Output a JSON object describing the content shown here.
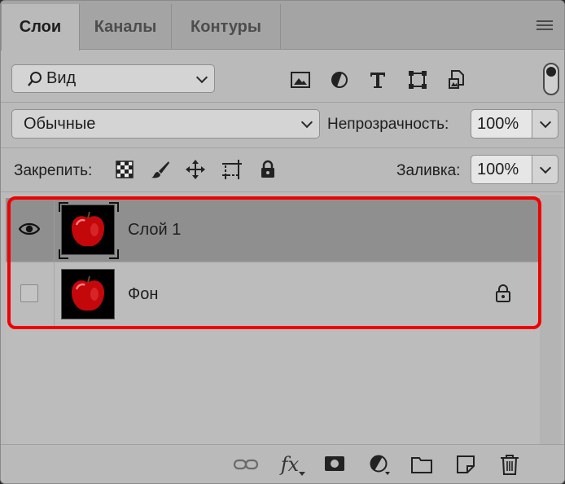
{
  "tabs": [
    {
      "label": "Слои",
      "active": true
    },
    {
      "label": "Каналы",
      "active": false
    },
    {
      "label": "Контуры",
      "active": false
    }
  ],
  "filter": {
    "kind_label": "Вид",
    "icons": [
      "image-filter-icon",
      "adjustment-filter-icon",
      "type-filter-icon",
      "shape-filter-icon",
      "smart-object-filter-icon"
    ]
  },
  "blend": {
    "mode": "Обычные",
    "opacity_label": "Непрозрачность:",
    "opacity_value": "100%"
  },
  "lock": {
    "label": "Закрепить:",
    "icons": [
      "lock-transparency-icon",
      "lock-pixels-icon",
      "lock-position-icon",
      "lock-artboard-icon",
      "lock-all-icon"
    ],
    "fill_label": "Заливка:",
    "fill_value": "100%"
  },
  "layers": [
    {
      "name": "Слой 1",
      "visible": true,
      "selected": true,
      "locked": false
    },
    {
      "name": "Фон",
      "visible": false,
      "selected": false,
      "locked": true
    }
  ],
  "footer_icons": [
    "link-layers-icon",
    "fx-icon",
    "add-mask-icon",
    "adjustment-layer-icon",
    "new-group-icon",
    "new-layer-icon",
    "delete-layer-icon"
  ],
  "colors": {
    "highlight": "#f00000",
    "selected_row": "#8f8f8f",
    "panel": "#bababa"
  }
}
